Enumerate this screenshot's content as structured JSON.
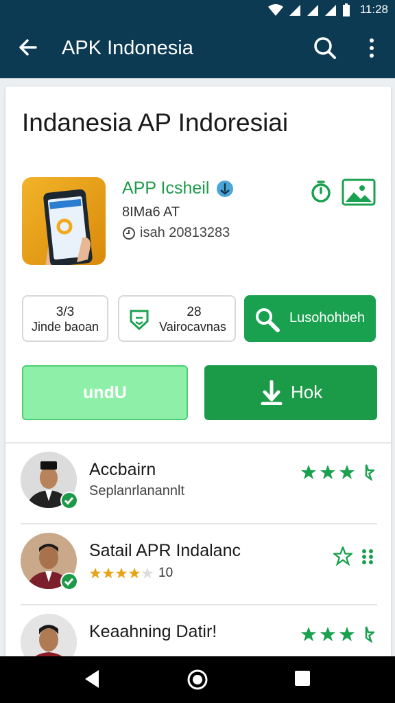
{
  "status_bar": {
    "time": "11:28"
  },
  "appbar": {
    "title": "APK Indonesia"
  },
  "header": {
    "heading": "Indanesia AP Indoresiai"
  },
  "app": {
    "name": "APP Icsheil",
    "developer": "8IMa6 AT",
    "date": "isah 20813283"
  },
  "stats": [
    {
      "number": "3/3",
      "label": "Jinde baoan"
    },
    {
      "number": "28",
      "label": "Vairocavnas"
    }
  ],
  "buttons": {
    "search_label": "Lusohohbeh",
    "light_label": "undU",
    "dark_label": "Hok"
  },
  "reviews": [
    {
      "name": "Accbairn",
      "sub": "Seplanrlanannlt",
      "rating_text": ""
    },
    {
      "name": "Satail APR Indalanc",
      "sub": "",
      "rating_text": "10"
    },
    {
      "name": "Keaahning Datir!",
      "sub": "",
      "rating_text": ""
    }
  ],
  "colors": {
    "appbar": "#0c3a52",
    "accent_green": "#1aa14f",
    "light_green": "#8ef0a8",
    "gold": "#e8a317"
  }
}
